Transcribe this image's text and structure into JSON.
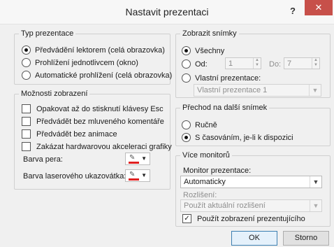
{
  "window": {
    "title": "Nastavit prezentaci",
    "help": "?",
    "close": "✕"
  },
  "show_type": {
    "legend": "Typ prezentace",
    "options": [
      {
        "label": "Předvádění lektorem (celá obrazovka)",
        "checked": true
      },
      {
        "label": "Prohlížení jednotlivcem (okno)",
        "checked": false
      },
      {
        "label": "Automatické prohlížení (celá obrazovka)",
        "checked": false
      }
    ]
  },
  "show_options": {
    "legend": "Možnosti zobrazení",
    "checks": [
      {
        "label": "Opakovat až do stisknutí klávesy Esc",
        "checked": false
      },
      {
        "label": "Předvádět bez mluveného komentáře",
        "checked": false
      },
      {
        "label": "Předvádět bez animace",
        "checked": false
      },
      {
        "label": "Zakázat hardwarovou akceleraci grafiky",
        "checked": false
      }
    ],
    "pen_color_label": "Barva pera:",
    "laser_color_label": "Barva laserového ukazovátka:",
    "pen_color": "#e02020",
    "laser_color": "#e02020"
  },
  "show_slides": {
    "legend": "Zobrazit snímky",
    "all_label": "Všechny",
    "from_label": "Od:",
    "from_value": "1",
    "to_label": "Do:",
    "to_value": "7",
    "custom_label": "Vlastní prezentace:",
    "custom_value": "Vlastní prezentace 1"
  },
  "advance": {
    "legend": "Přechod na další snímek",
    "manual_label": "Ručně",
    "timing_label": "S časováním, je-li k dispozici"
  },
  "monitors": {
    "legend": "Více monitorů",
    "monitor_label": "Monitor prezentace:",
    "monitor_value": "Automaticky",
    "resolution_label": "Rozlišení:",
    "resolution_value": "Použít aktuální rozlišení",
    "presenter_view_label": "Použít zobrazení prezentujícího",
    "presenter_view_checked": true
  },
  "buttons": {
    "ok": "OK",
    "cancel": "Storno"
  }
}
